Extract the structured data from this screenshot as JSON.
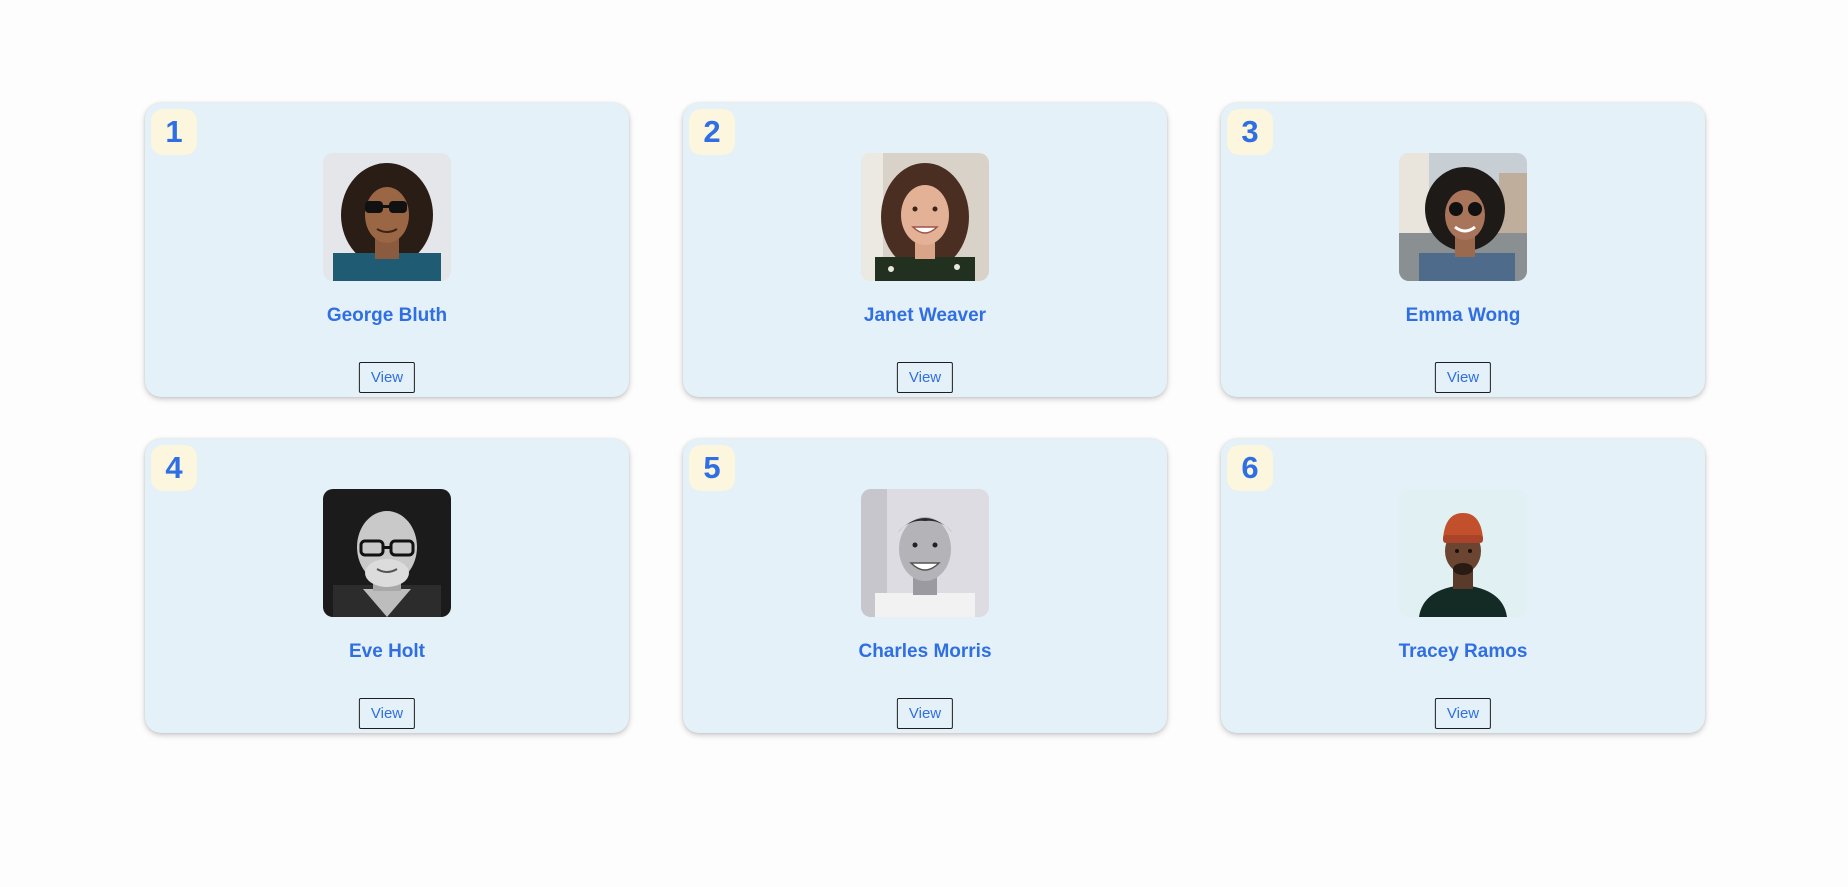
{
  "users": [
    {
      "id": "1",
      "name": "George Bluth",
      "button_label": "View"
    },
    {
      "id": "2",
      "name": "Janet Weaver",
      "button_label": "View"
    },
    {
      "id": "3",
      "name": "Emma Wong",
      "button_label": "View"
    },
    {
      "id": "4",
      "name": "Eve Holt",
      "button_label": "View"
    },
    {
      "id": "5",
      "name": "Charles Morris",
      "button_label": "View"
    },
    {
      "id": "6",
      "name": "Tracey Ramos",
      "button_label": "View"
    }
  ],
  "colors": {
    "card_background": "#e5f1f8",
    "badge_background": "#fbf6dd",
    "accent": "#2f6fe3"
  }
}
